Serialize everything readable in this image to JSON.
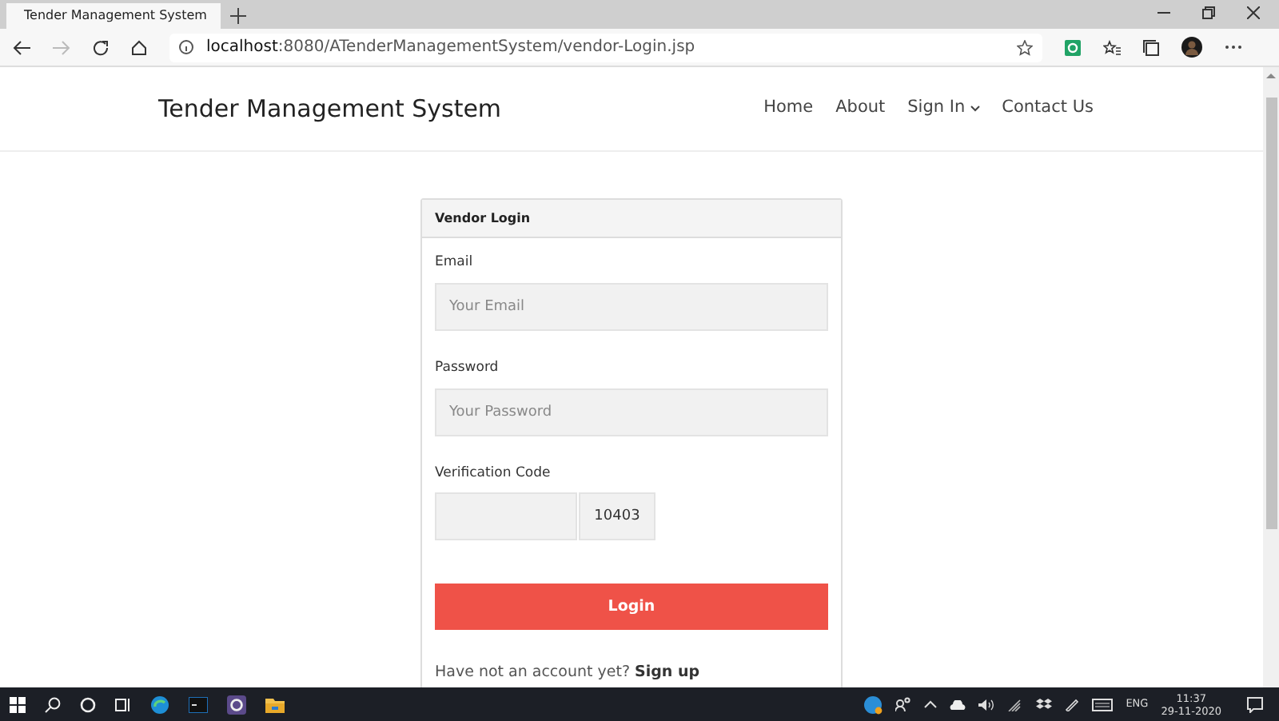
{
  "browser": {
    "tab_title": "Tender Management System",
    "url_host": "localhost",
    "url_rest": ":8080/ATenderManagementSystem/vendor-Login.jsp"
  },
  "navbar": {
    "brand": "Tender Management System",
    "items": [
      {
        "label": "Home",
        "kind": "link"
      },
      {
        "label": "About",
        "kind": "link"
      },
      {
        "label": "Sign In",
        "kind": "dropdown"
      },
      {
        "label": "Contact Us",
        "kind": "link"
      }
    ]
  },
  "login_card": {
    "title": "Vendor Login",
    "fields": [
      {
        "label": "Email",
        "placeholder": "Your Email",
        "kind": "text"
      },
      {
        "label": "Password",
        "placeholder": "Your Password",
        "kind": "text"
      },
      {
        "label": "Verification Code",
        "kind": "captcha",
        "code": "10403"
      }
    ],
    "button": "Login",
    "footer_text": "Have not an account yet?",
    "footer_link": "Sign up"
  },
  "taskbar": {
    "language": "ENG",
    "time": "11:37",
    "date": "29-11-2020"
  }
}
